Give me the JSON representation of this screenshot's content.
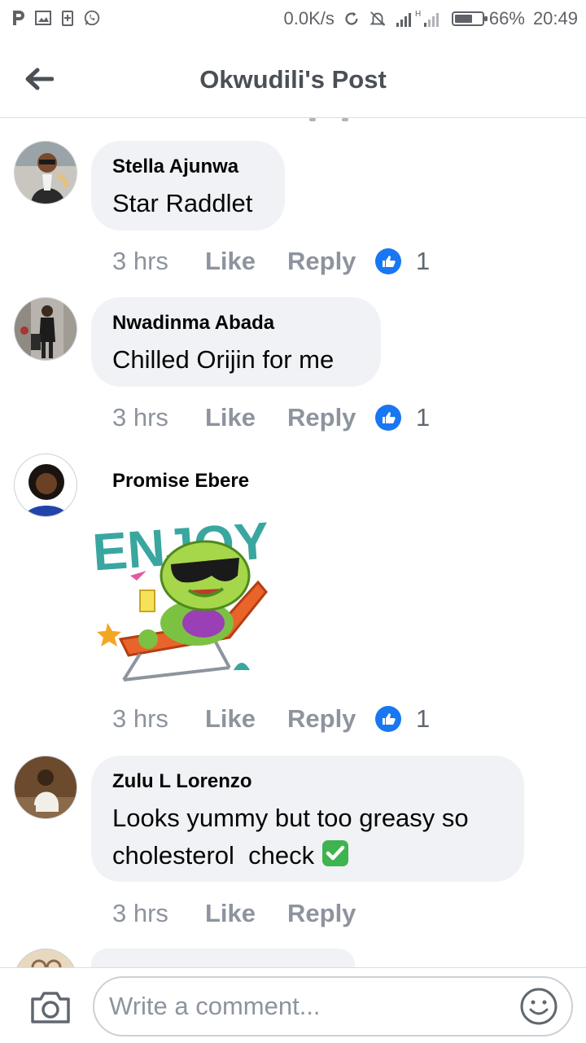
{
  "status_bar": {
    "left_icons": [
      "p-icon",
      "image-notification-icon",
      "battery-saver-icon",
      "whatsapp-icon"
    ],
    "net_speed": "0.0K/s",
    "battery_level": 0.66,
    "battery_text": "66%",
    "time": "20:49",
    "signal_h_label": "H"
  },
  "header": {
    "back_icon": "arrow-left-icon",
    "title": "Okwudili's Post"
  },
  "comments": [
    {
      "author": "Stella Ajunwa",
      "text": "Star Raddlet",
      "time": "3 hrs",
      "like_label": "Like",
      "reply_label": "Reply",
      "reaction_count": "1"
    },
    {
      "author": "Nwadinma Abada",
      "text": "Chilled Orijin for me",
      "time": "3 hrs",
      "like_label": "Like",
      "reply_label": "Reply",
      "reaction_count": "1"
    },
    {
      "author": "Promise Ebere",
      "sticker_text": "ENJOY!",
      "time": "3 hrs",
      "like_label": "Like",
      "reply_label": "Reply",
      "reaction_count": "1"
    },
    {
      "author": "Zulu L Lorenzo",
      "text_line1": "Looks yummy but too greasy so",
      "text_line2": "cholesterol  check",
      "text_emoji": "✅",
      "time": "3 hrs",
      "like_label": "Like",
      "reply_label": "Reply"
    }
  ],
  "composer": {
    "placeholder": "Write a comment...",
    "camera_icon": "camera-icon",
    "emoji_icon": "smiley-icon"
  },
  "colors": {
    "accent_blue": "#1877f2",
    "bubble_bg": "#f0f2f5",
    "meta_gray": "#8d949e",
    "sticker_teal": "#3aa6a0"
  }
}
